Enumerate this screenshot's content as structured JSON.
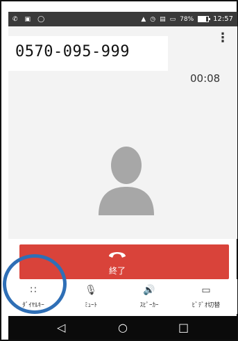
{
  "status_bar": {
    "icons_left": [
      "phone-icon",
      "photo-icon",
      "shield-icon"
    ],
    "icons_right": [
      "signal-icon",
      "alarm-icon",
      "lte-icon",
      "cell-signal-icon"
    ],
    "battery": "78%",
    "battery_level": 0.78,
    "time": "12:57"
  },
  "call": {
    "number": "0570-095-999",
    "elapsed": "00:08",
    "end_label": "終了",
    "menu_icon": "more-vert-icon"
  },
  "controls": [
    {
      "name": "dialpad",
      "label": "ﾀﾞｲﾔﾙｷｰ",
      "icon": "dialpad-icon"
    },
    {
      "name": "mute",
      "label": "ﾐｭｰﾄ",
      "icon": "mic-off-icon"
    },
    {
      "name": "speaker",
      "label": "ｽﾋﾟｰｶｰ",
      "icon": "speaker-icon"
    },
    {
      "name": "video",
      "label": "ﾋﾞﾃﾞｵ切替",
      "icon": "video-icon"
    }
  ],
  "nav": {
    "back": "◁",
    "home": "○",
    "recents": "□"
  },
  "colors": {
    "end_call": "#d9433a",
    "highlight": "#2f6fb6",
    "status_bar": "#3a3a3a",
    "nav_bar": "#0b0b0b"
  }
}
